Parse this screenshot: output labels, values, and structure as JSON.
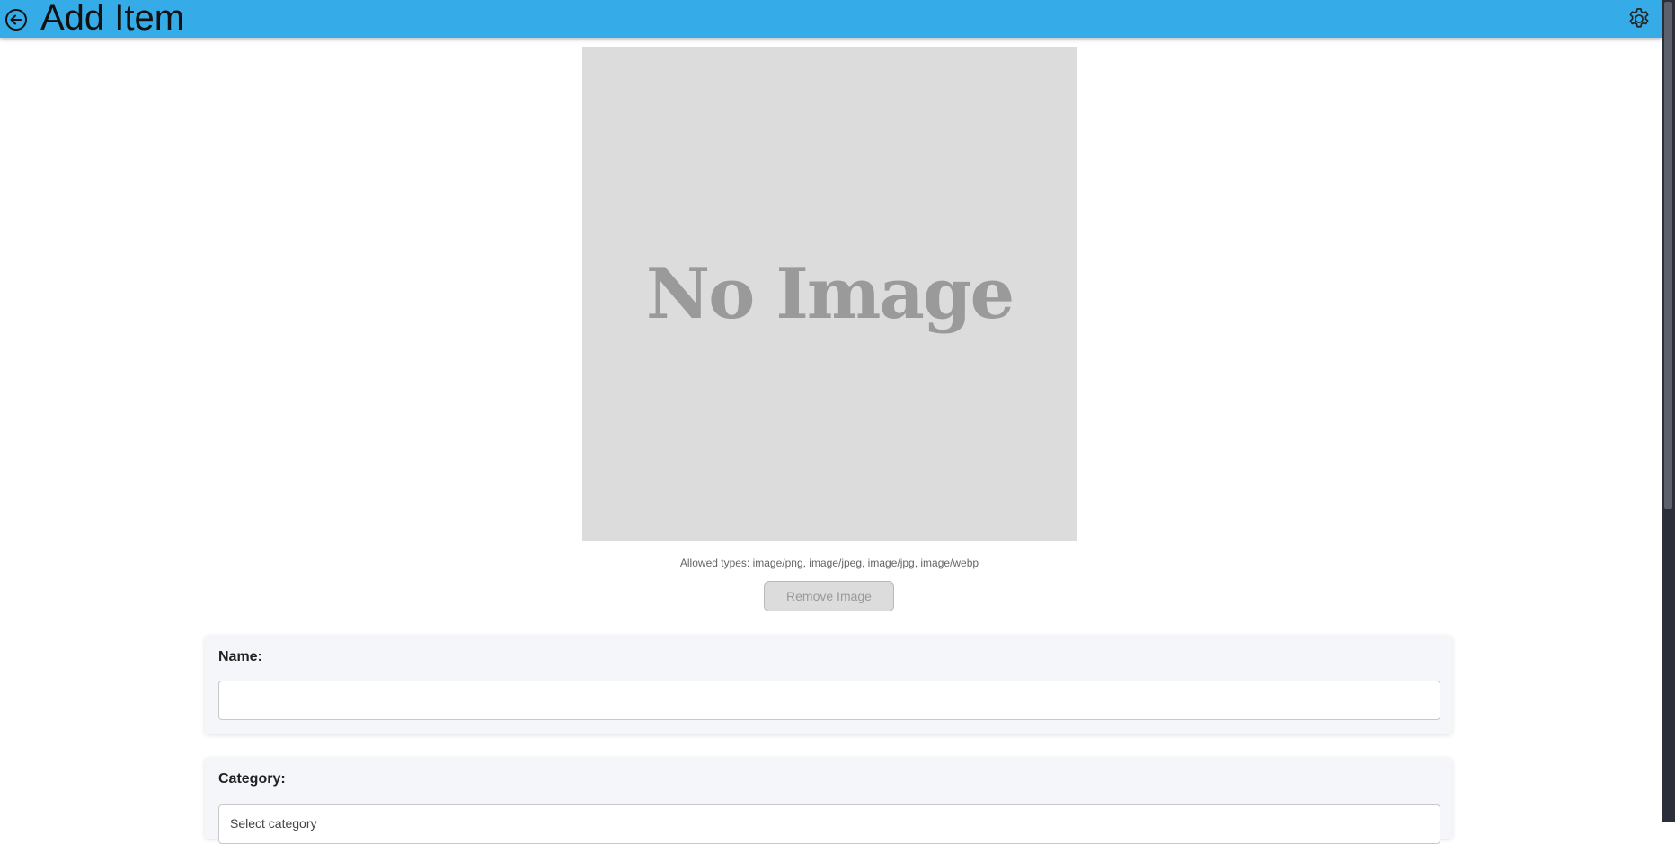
{
  "header": {
    "title": "Add Item",
    "back_icon": "back-arrow-circle-icon",
    "settings_icon": "gear-icon",
    "color": "#35ace8"
  },
  "image_preview": {
    "placeholder_text": "No Image",
    "allowed_types": "Allowed types: image/png, image/jpeg, image/jpg, image/webp",
    "remove_button_label": "Remove Image"
  },
  "form": {
    "name": {
      "label": "Name:",
      "value": "",
      "placeholder": ""
    },
    "category": {
      "label": "Category:",
      "selected": "Select category"
    }
  }
}
